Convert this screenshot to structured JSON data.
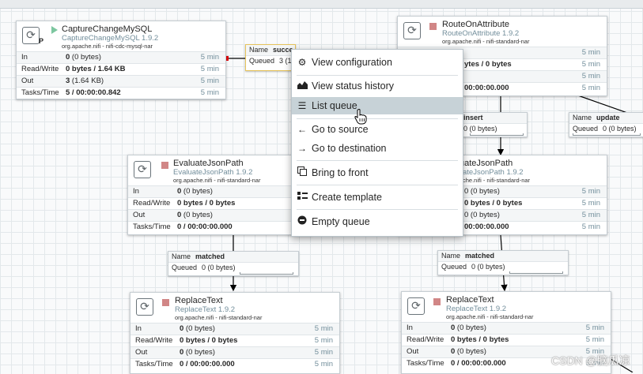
{
  "processors": {
    "capture": {
      "name": "CaptureChangeMySQL",
      "type": "CaptureChangeMySQL 1.9.2",
      "bundle": "org.apache.nifi - nifi-cdc-mysql-nar",
      "badge": "P",
      "stats": [
        {
          "label": "In",
          "value": "0",
          "extra": " (0 bytes)",
          "time": "5 min"
        },
        {
          "label": "Read/Write",
          "value": "0 bytes / 1.64 KB",
          "extra": "",
          "time": "5 min"
        },
        {
          "label": "Out",
          "value": "3",
          "extra": " (1.64 KB)",
          "time": "5 min"
        },
        {
          "label": "Tasks/Time",
          "value": "5 / 00:00:00.842",
          "extra": "",
          "time": "5 min"
        }
      ]
    },
    "route": {
      "name": "RouteOnAttribute",
      "type": "RouteOnAttribute 1.9.2",
      "bundle": "org.apache.nifi - nifi-standard-nar",
      "stats": [
        {
          "label": "In",
          "value": "",
          "extra": "",
          "time": "5 min"
        },
        {
          "label": "Read/Write",
          "value": "ytes / 0 bytes",
          "extra": "",
          "time": "5 min"
        },
        {
          "label": "Out",
          "value": "",
          "extra": "",
          "time": "5 min"
        },
        {
          "label": "Tasks/Time",
          "value": "00:00:00.000",
          "extra": "",
          "time": "5 min"
        }
      ]
    },
    "evaluate1": {
      "name": "EvaluateJsonPath",
      "type": "EvaluateJsonPath 1.9.2",
      "bundle": "org.apache.nifi - nifi-standard-nar",
      "stats": [
        {
          "label": "In",
          "value": "0",
          "extra": " (0 bytes)",
          "time": ""
        },
        {
          "label": "Read/Write",
          "value": "0 bytes / 0 bytes",
          "extra": "",
          "time": ""
        },
        {
          "label": "Out",
          "value": "0",
          "extra": " (0 bytes)",
          "time": ""
        },
        {
          "label": "Tasks/Time",
          "value": "0 / 00:00:00.000",
          "extra": "",
          "time": ""
        }
      ]
    },
    "evaluate2": {
      "name": "uateJsonPath",
      "type": "ateJsonPath 1.9.2",
      "bundle": "che.nifi - nifi-standard-nar",
      "stats": [
        {
          "label": "",
          "value": "",
          "extra": "0 (0 bytes)",
          "time": "5 min"
        },
        {
          "label": "",
          "value": "",
          "extra": "0 bytes / 0 bytes",
          "time": "5 min"
        },
        {
          "label": "",
          "value": "",
          "extra": "0 (0 bytes)",
          "time": "5 min"
        },
        {
          "label": "",
          "value": "",
          "extra": "00:00:00.000",
          "time": "5 min"
        }
      ]
    },
    "replace1": {
      "name": "ReplaceText",
      "type": "ReplaceText 1.9.2",
      "bundle": "org.apache.nifi - nifi-standard-nar",
      "stats": [
        {
          "label": "In",
          "value": "0",
          "extra": " (0 bytes)",
          "time": "5 min"
        },
        {
          "label": "Read/Write",
          "value": "0 bytes / 0 bytes",
          "extra": "",
          "time": "5 min"
        },
        {
          "label": "Out",
          "value": "0",
          "extra": " (0 bytes)",
          "time": "5 min"
        },
        {
          "label": "Tasks/Time",
          "value": "0 / 00:00:00.000",
          "extra": "",
          "time": "5 min"
        }
      ]
    },
    "replace2": {
      "name": "ReplaceText",
      "type": "ReplaceText 1.9.2",
      "bundle": "org.apache.nifi - nifi-standard-nar",
      "stats": [
        {
          "label": "In",
          "value": "0",
          "extra": " (0 bytes)",
          "time": "5 min"
        },
        {
          "label": "Read/Write",
          "value": "0 bytes / 0 bytes",
          "extra": "",
          "time": "5 min"
        },
        {
          "label": "Out",
          "value": "0",
          "extra": " (0 bytes)",
          "time": "5 min"
        },
        {
          "label": "Tasks/Time",
          "value": "0 / 00:00:00.000",
          "extra": "",
          "time": "5 min"
        }
      ]
    }
  },
  "connections": {
    "success": {
      "name_label": "Name",
      "name": "succe",
      "queued_label": "Queued",
      "queued": "3 (1"
    },
    "insert": {
      "name_label": "",
      "name": "insert",
      "queued_label": "",
      "queued": "0 (0 bytes)"
    },
    "update": {
      "name_label": "Name",
      "name": "update",
      "queued_label": "Queued",
      "queued": "0 (0 bytes)"
    },
    "matched1": {
      "name_label": "Name",
      "name": "matched",
      "queued_label": "Queued",
      "queued": "0 (0 bytes)"
    },
    "matched2": {
      "name_label": "Name",
      "name": "matched",
      "queued_label": "Queued",
      "queued": "0 (0 bytes)"
    }
  },
  "context_menu": {
    "items": [
      {
        "label": "View configuration",
        "icon": "gear-icon"
      },
      {
        "label": "View status history",
        "icon": "area-chart-icon"
      },
      {
        "label": "List queue",
        "icon": "list-icon"
      },
      {
        "label": "Go to source",
        "icon": "arrow-left-icon"
      },
      {
        "label": "Go to destination",
        "icon": "arrow-right-icon"
      },
      {
        "label": "Bring to front",
        "icon": "bring-front-icon"
      },
      {
        "label": "Create template",
        "icon": "template-icon"
      },
      {
        "label": "Empty queue",
        "icon": "minus-circle-icon"
      }
    ],
    "highlighted": "List queue"
  },
  "watermark": "CSDN @脑瓜凉",
  "colors": {
    "running": "#7dc7a0",
    "stopped": "#d18686",
    "selected_border": "#e6c35a",
    "canvas": "#f9fafb"
  }
}
